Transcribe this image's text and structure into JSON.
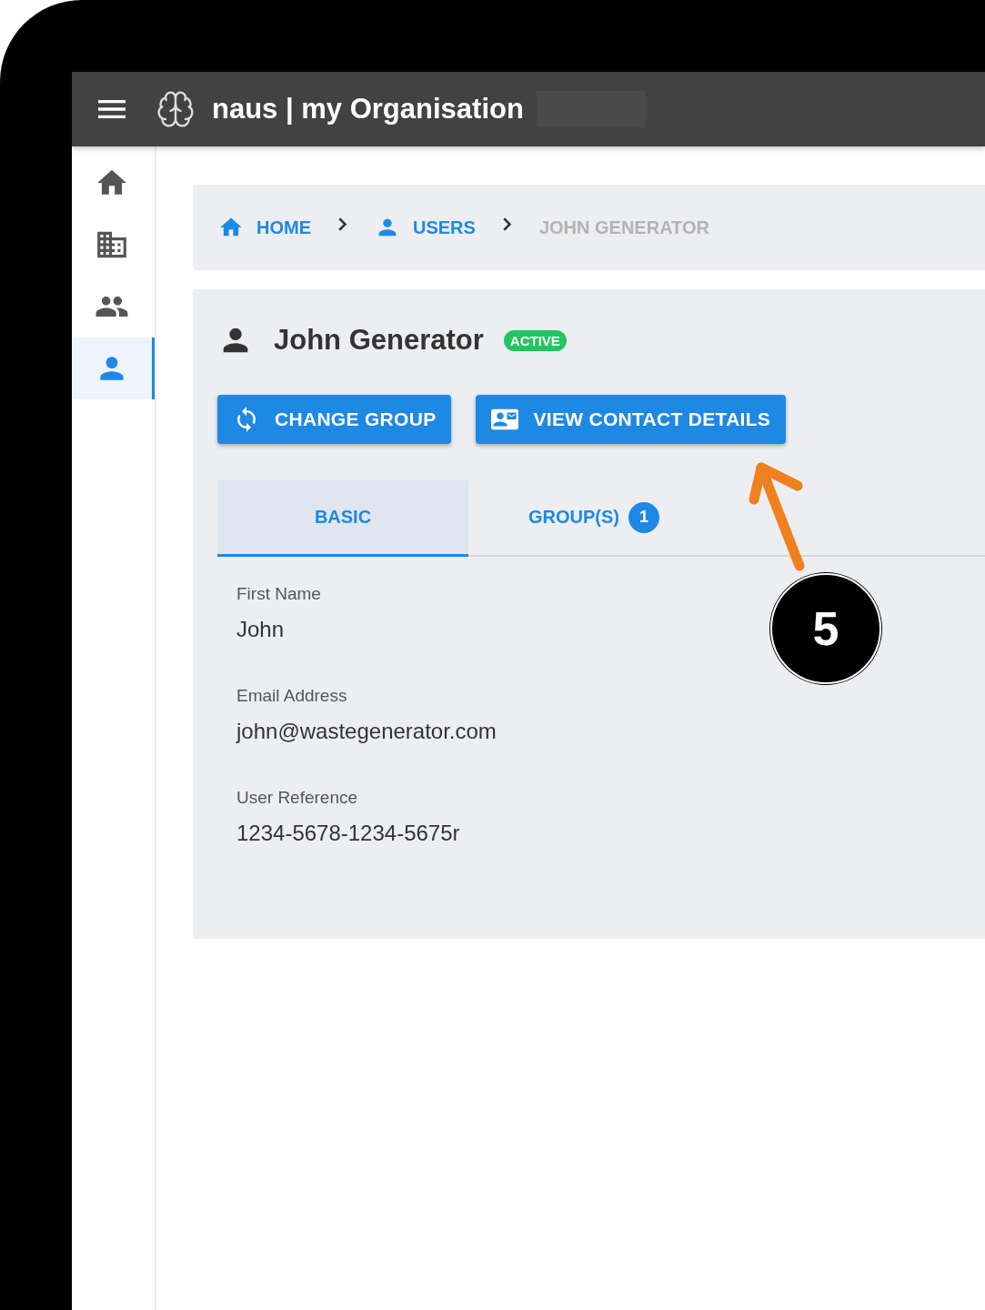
{
  "app_bar": {
    "title": "naus | my Organisation"
  },
  "sidebar": {
    "items": [
      {
        "kind": "home",
        "selected": false
      },
      {
        "kind": "building",
        "selected": false
      },
      {
        "kind": "group",
        "selected": false
      },
      {
        "kind": "person",
        "selected": true
      }
    ]
  },
  "breadcrumbs": [
    {
      "label": "HOME",
      "kind": "home",
      "current": false
    },
    {
      "label": "USERS",
      "kind": "person",
      "current": false
    },
    {
      "label": "JOHN GENERATOR",
      "kind": "none",
      "current": true
    }
  ],
  "user": {
    "name": "John Generator",
    "status": "ACTIVE"
  },
  "buttons": [
    {
      "label": "CHANGE GROUP",
      "kind": "sync"
    },
    {
      "label": "VIEW CONTACT DETAILS",
      "kind": "contact"
    }
  ],
  "tabs": [
    {
      "label": "BASIC",
      "selected": true
    },
    {
      "label": "GROUP(S)",
      "selected": false,
      "badge": "1"
    }
  ],
  "fields": [
    {
      "label": "First Name",
      "value": "John"
    },
    {
      "label": "Email Address",
      "value": "john@wastegenerator.com"
    },
    {
      "label": "User Reference",
      "value": "1234-5678-1234-5675r"
    }
  ],
  "callout": {
    "number": "5"
  }
}
